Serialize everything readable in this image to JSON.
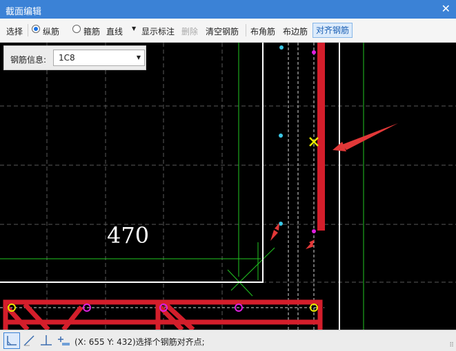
{
  "window": {
    "title": "截面编辑",
    "close_glyph": "✕"
  },
  "toolbar": {
    "select": "选择",
    "longitudinal": "纵筋",
    "stirrup": "箍筋",
    "line_mode": "直线",
    "show_annotation": "显示标注",
    "delete": "删除",
    "clear_rebar": "清空钢筋",
    "corner_rebar": "布角筋",
    "edge_rebar": "布边筋",
    "align_rebar": "对齐钢筋"
  },
  "rebar_info": {
    "label": "钢筋信息:",
    "value": "1C8"
  },
  "canvas": {
    "dimension": "470"
  },
  "status": {
    "text": "(X: 655 Y: 432)选择个钢筋对齐点;"
  },
  "colors": {
    "accent": "#3b82d6",
    "rebar": "#d41e2b",
    "highlight": "#e8e800",
    "point": "#3cc8e6",
    "node": "#e020e0"
  }
}
